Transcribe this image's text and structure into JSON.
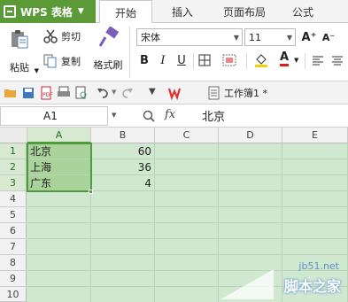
{
  "app": {
    "name": "WPS 表格",
    "tabs": [
      {
        "label": "开始",
        "active": true
      },
      {
        "label": "插入",
        "active": false
      },
      {
        "label": "页面布局",
        "active": false
      },
      {
        "label": "公式",
        "active": false
      }
    ]
  },
  "ribbon": {
    "paste_label": "粘贴",
    "cut_label": "剪切",
    "copy_label": "复制",
    "format_painter_label": "格式刷",
    "font_name": "宋体",
    "font_size": "11",
    "bold": "B",
    "italic": "I",
    "underline": "U",
    "grow_font": "A⁺",
    "shrink_font": "A⁻",
    "font_color": "A"
  },
  "quick_access": {
    "document_name": "工作簿1 *"
  },
  "formula_bar": {
    "cell_ref": "A1",
    "fx": "fx",
    "content": "北京"
  },
  "sheet": {
    "columns": [
      "A",
      "B",
      "C",
      "D",
      "E"
    ],
    "rows": [
      "1",
      "2",
      "3",
      "4",
      "5",
      "6",
      "7",
      "8",
      "9",
      "10"
    ],
    "cells": [
      [
        "北京",
        "60"
      ],
      [
        "上海",
        "36"
      ],
      [
        "广东",
        "4"
      ]
    ]
  },
  "watermark": {
    "url": "jb51.net",
    "text": "脚本之家"
  },
  "colors": {
    "accent": "#5b9a37",
    "grid_background": "#cfe8cf",
    "selection": "#a9d39a",
    "selection_border": "#4e9a3c"
  }
}
